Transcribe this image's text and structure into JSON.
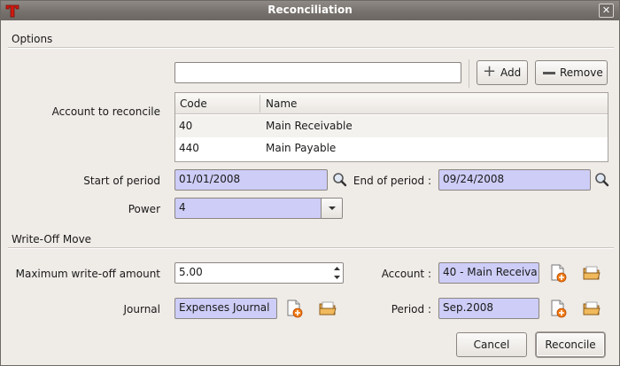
{
  "window": {
    "title": "Reconciliation"
  },
  "options": {
    "section_title": "Options",
    "search_value": "",
    "add_label": "Add",
    "remove_label": "Remove",
    "account_label": "Account to reconcile",
    "table": {
      "columns": [
        "Code",
        "Name"
      ],
      "rows": [
        {
          "code": "40",
          "name": "Main Receivable"
        },
        {
          "code": "440",
          "name": "Main Payable"
        }
      ]
    },
    "start_label": "Start of period",
    "start_value": "01/01/2008",
    "end_label": "End of period :",
    "end_value": "09/24/2008",
    "power_label": "Power",
    "power_value": "4"
  },
  "writeoff": {
    "section_title": "Write-Off Move",
    "max_label": "Maximum write-off amount",
    "max_value": "5.00",
    "account_label": "Account :",
    "account_value": "40 - Main Receiva",
    "journal_label": "Journal",
    "journal_value": "Expenses Journal",
    "period_label": "Period :",
    "period_value": "Sep.2008"
  },
  "actions": {
    "cancel_label": "Cancel",
    "reconcile_label": "Reconcile"
  }
}
